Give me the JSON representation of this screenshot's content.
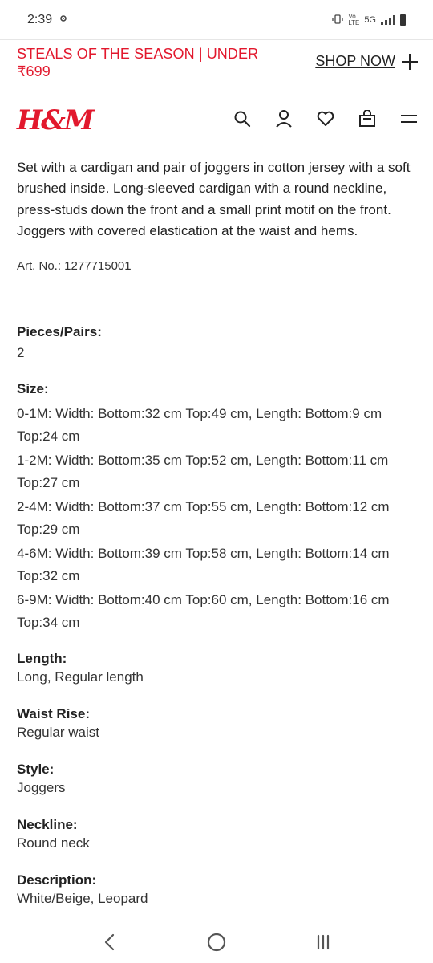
{
  "status_bar": {
    "time": "2:39",
    "network_label": "5G",
    "volte_label": "Vo LTE"
  },
  "promo": {
    "text": "STEALS OF THE SEASON | UNDER ₹699",
    "shop_now": "SHOP NOW"
  },
  "header": {
    "logo": "H&M"
  },
  "product": {
    "description": "Set with a cardigan and pair of joggers in cotton jersey with a soft brushed inside. Long-sleeved cardigan with a round neckline, press-studs down the front and a small print motif on the front. Joggers with covered elastication at the waist and hems.",
    "art_no": "Art. No.: 1277715001"
  },
  "attributes": {
    "pieces": {
      "label": "Pieces/Pairs:",
      "value": "2"
    },
    "size": {
      "label": "Size:",
      "lines": [
        "0-1M: Width: Bottom:32 cm Top:49 cm, Length: Bottom:9 cm Top:24 cm",
        "1-2M: Width: Bottom:35 cm Top:52 cm, Length: Bottom:11 cm Top:27 cm",
        "2-4M: Width: Bottom:37 cm Top:55 cm, Length: Bottom:12 cm Top:29 cm",
        "4-6M: Width: Bottom:39 cm Top:58 cm, Length: Bottom:14 cm Top:32 cm",
        "6-9M: Width: Bottom:40 cm Top:60 cm, Length: Bottom:16 cm Top:34 cm"
      ]
    },
    "length": {
      "label": "Length:",
      "value": "Long, Regular length"
    },
    "waist_rise": {
      "label": "Waist Rise:",
      "value": "Regular waist"
    },
    "style": {
      "label": "Style:",
      "value": "Joggers"
    },
    "neckline": {
      "label": "Neckline:",
      "value": "Round neck"
    },
    "description": {
      "label": "Description:",
      "value": "White/Beige, Leopard"
    }
  },
  "icons": {
    "search": "search-icon",
    "account": "account-icon",
    "favorites": "heart-icon",
    "bag": "shopping-bag-icon",
    "menu": "menu-icon"
  },
  "colors": {
    "brand_red": "#e2182d",
    "text": "#222222"
  }
}
